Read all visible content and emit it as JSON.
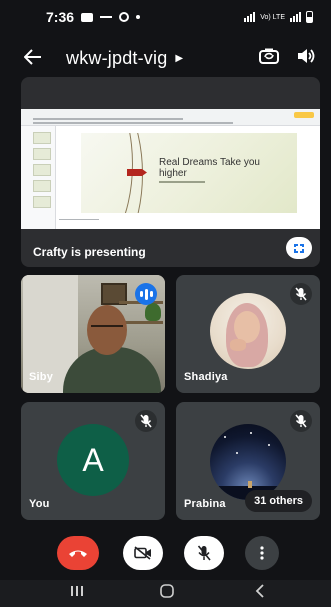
{
  "status_bar": {
    "time": "7:36",
    "network_label": "Vo) LTE"
  },
  "app_bar": {
    "meeting_code": "wkw-jpdt-vig"
  },
  "presentation": {
    "presenter_label": "Crafty is presenting",
    "slide_title": "Real Dreams Take you higher"
  },
  "participants": [
    {
      "name": "Siby",
      "state": "speaking"
    },
    {
      "name": "Shadiya",
      "state": "muted"
    },
    {
      "name": "You",
      "avatar_letter": "A",
      "state": "muted"
    },
    {
      "name": "Prabina",
      "state": "muted"
    }
  ],
  "others_label": "31 others",
  "colors": {
    "background": "#121316",
    "tile": "#3c4043",
    "end_call": "#ea4335",
    "accent": "#1a73e8",
    "self_avatar": "#0e5f47"
  },
  "icons": {
    "back": "arrow-left",
    "switch_camera": "camera-switch",
    "speaker": "volume",
    "fullscreen": "fullscreen",
    "mic_off": "mic-off",
    "cam_off": "videocam-off",
    "end_call": "call-end",
    "more": "more-vertical"
  }
}
